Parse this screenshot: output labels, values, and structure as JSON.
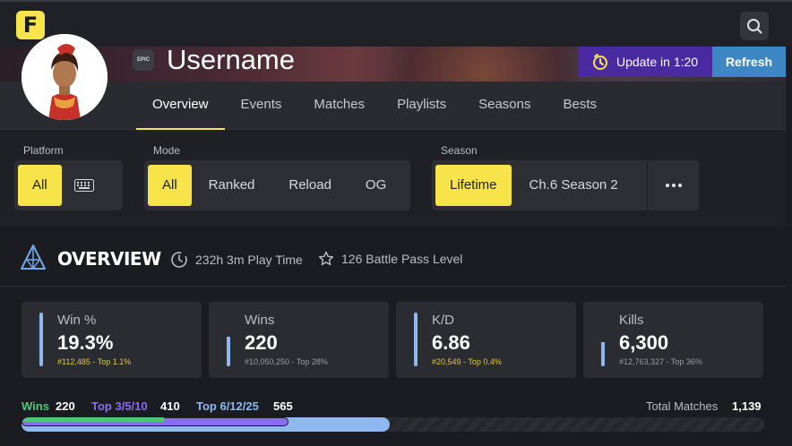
{
  "header": {
    "logo_letter": "F",
    "search_icon": "search-icon"
  },
  "profile": {
    "username": "Username",
    "badge_text": "EPIC"
  },
  "actions": {
    "update_label": "Update in 1:20",
    "refresh_label": "Refresh"
  },
  "tabs": [
    {
      "label": "Overview",
      "active": true
    },
    {
      "label": "Events"
    },
    {
      "label": "Matches"
    },
    {
      "label": "Playlists"
    },
    {
      "label": "Seasons"
    },
    {
      "label": "Bests"
    }
  ],
  "filters": {
    "platform": {
      "label": "Platform",
      "options": [
        "All",
        "keyboard-icon"
      ],
      "selected": "All"
    },
    "mode": {
      "label": "Mode",
      "options": [
        "All",
        "Ranked",
        "Reload",
        "OG"
      ],
      "selected": "All"
    },
    "season": {
      "label": "Season",
      "options": [
        "Lifetime",
        "Ch.6 Season 2"
      ],
      "selected": "Lifetime",
      "more_icon": "ellipsis-icon"
    }
  },
  "overview": {
    "title": "OVERVIEW",
    "play_time": "232h 3m Play Time",
    "battle_pass": "126 Battle Pass Level"
  },
  "stat_cards": [
    {
      "label": "Win %",
      "value": "19.3%",
      "rank": "#112,485 - Top 1.1%",
      "highlight": true,
      "accent": "#8fb8f0"
    },
    {
      "label": "Wins",
      "value": "220",
      "rank": "#10,050,250 - Top 28%",
      "highlight": false,
      "accent": "#8fb8f0"
    },
    {
      "label": "K/D",
      "value": "6.86",
      "rank": "#20,549 - Top 0.4%",
      "highlight": true,
      "accent": "#8fb8f0"
    },
    {
      "label": "Kills",
      "value": "6,300",
      "rank": "#12,763,327 - Top 36%",
      "highlight": false,
      "accent": "#8fb8f0"
    }
  ],
  "placements": {
    "wins_label": "Wins",
    "wins_value": "220",
    "top_a_label": "Top 3/5/10",
    "top_a_value": "410",
    "top_b_label": "Top 6/12/25",
    "top_b_value": "565",
    "total_label": "Total Matches",
    "total_value": "1,139",
    "total": 1139,
    "wins": 220,
    "top_a": 410,
    "top_b": 565,
    "colors": {
      "wins": "#4cc77a",
      "top_a": "#8a6cf0",
      "top_b": "#8fb8f0"
    }
  },
  "colors": {
    "accent_yellow": "#f7e44a",
    "update_purple": "#4a2aa0",
    "refresh_blue": "#3d87c4",
    "gold_rank": "#e4c74a"
  }
}
